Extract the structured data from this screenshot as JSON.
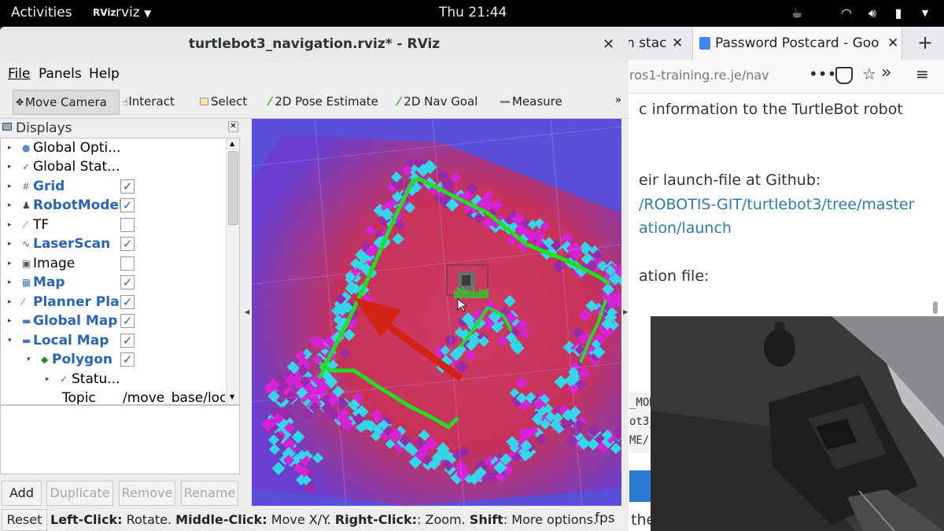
{
  "topbar": {
    "activities": "Activities",
    "app_name": "rviz",
    "clock": "Thu 21:44"
  },
  "browser": {
    "tab1_label": "n stac",
    "tab2_label": "Password Postcard - Goo",
    "url": "ros1-training.re.je/nav",
    "article_lines": [
      "c information to the TurtleBot robot",
      "eir launch-file at Github:",
      "/ROBOTIS-GIT/turtlebot3/tree/master",
      "ation/launch",
      "ation file:"
    ],
    "code_fragments": [
      "_MOD",
      "ot3_",
      "ME/r"
    ],
    "bottom_text": "the"
  },
  "rviz": {
    "title": "turtlebot3_navigation.rviz* - RViz",
    "menu": [
      "File",
      "Panels",
      "Help"
    ],
    "tools": {
      "move_camera": "Move Camera",
      "interact": "Interact",
      "select": "Select",
      "pose_estimate": "2D Pose Estimate",
      "nav_goal": "2D Nav Goal",
      "measure": "Measure"
    },
    "displays": {
      "header": "Displays",
      "items": [
        {
          "label": "Global Opti...",
          "checked": null
        },
        {
          "label": "Global Stat...",
          "checked": null
        },
        {
          "label": "Grid",
          "checked": true
        },
        {
          "label": "RobotModel",
          "checked": true
        },
        {
          "label": "TF",
          "checked": false
        },
        {
          "label": "LaserScan",
          "checked": true
        },
        {
          "label": "Image",
          "checked": false
        },
        {
          "label": "Map",
          "checked": true
        },
        {
          "label": "Planner Plan",
          "checked": true
        },
        {
          "label": "Global Map",
          "checked": true
        },
        {
          "label": "Local Map",
          "checked": true
        },
        {
          "label": "Polygon",
          "checked": true
        },
        {
          "label": "Statu...",
          "checked": null
        },
        {
          "label": "Topic",
          "checked": null
        }
      ],
      "topic_value": "/move_base/loc",
      "buttons": {
        "add": "Add",
        "duplicate": "Duplicate",
        "remove": "Remove",
        "rename": "Rename"
      }
    },
    "status": {
      "reset": "Reset",
      "left_click": "Left-Click:",
      "left_action": " Rotate. ",
      "middle_click": "Middle-Click:",
      "middle_action": " Move X/Y. ",
      "right_click": "Right-Click:",
      "right_action": ": Zoom. ",
      "shift": "Shift",
      "shift_action": ": More options.",
      "fps": "fps"
    }
  },
  "colors": {
    "accent_blue": "#2a64b5",
    "path_green": "#22dd22",
    "arrow_red": "#d42215"
  }
}
